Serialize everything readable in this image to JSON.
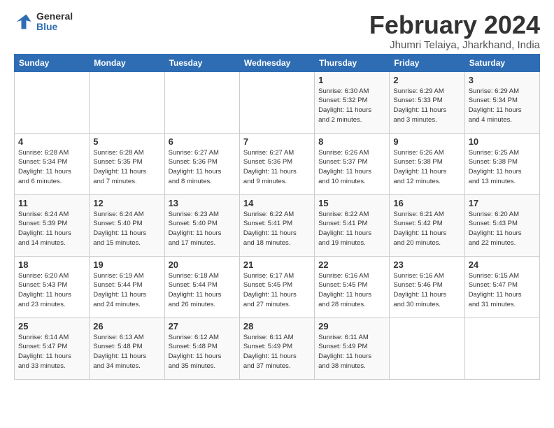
{
  "logo": {
    "general": "General",
    "blue": "Blue"
  },
  "title": "February 2024",
  "location": "Jhumri Telaiya, Jharkhand, India",
  "days_of_week": [
    "Sunday",
    "Monday",
    "Tuesday",
    "Wednesday",
    "Thursday",
    "Friday",
    "Saturday"
  ],
  "weeks": [
    [
      {
        "day": "",
        "info": ""
      },
      {
        "day": "",
        "info": ""
      },
      {
        "day": "",
        "info": ""
      },
      {
        "day": "",
        "info": ""
      },
      {
        "day": "1",
        "info": "Sunrise: 6:30 AM\nSunset: 5:32 PM\nDaylight: 11 hours\nand 2 minutes."
      },
      {
        "day": "2",
        "info": "Sunrise: 6:29 AM\nSunset: 5:33 PM\nDaylight: 11 hours\nand 3 minutes."
      },
      {
        "day": "3",
        "info": "Sunrise: 6:29 AM\nSunset: 5:34 PM\nDaylight: 11 hours\nand 4 minutes."
      }
    ],
    [
      {
        "day": "4",
        "info": "Sunrise: 6:28 AM\nSunset: 5:34 PM\nDaylight: 11 hours\nand 6 minutes."
      },
      {
        "day": "5",
        "info": "Sunrise: 6:28 AM\nSunset: 5:35 PM\nDaylight: 11 hours\nand 7 minutes."
      },
      {
        "day": "6",
        "info": "Sunrise: 6:27 AM\nSunset: 5:36 PM\nDaylight: 11 hours\nand 8 minutes."
      },
      {
        "day": "7",
        "info": "Sunrise: 6:27 AM\nSunset: 5:36 PM\nDaylight: 11 hours\nand 9 minutes."
      },
      {
        "day": "8",
        "info": "Sunrise: 6:26 AM\nSunset: 5:37 PM\nDaylight: 11 hours\nand 10 minutes."
      },
      {
        "day": "9",
        "info": "Sunrise: 6:26 AM\nSunset: 5:38 PM\nDaylight: 11 hours\nand 12 minutes."
      },
      {
        "day": "10",
        "info": "Sunrise: 6:25 AM\nSunset: 5:38 PM\nDaylight: 11 hours\nand 13 minutes."
      }
    ],
    [
      {
        "day": "11",
        "info": "Sunrise: 6:24 AM\nSunset: 5:39 PM\nDaylight: 11 hours\nand 14 minutes."
      },
      {
        "day": "12",
        "info": "Sunrise: 6:24 AM\nSunset: 5:40 PM\nDaylight: 11 hours\nand 15 minutes."
      },
      {
        "day": "13",
        "info": "Sunrise: 6:23 AM\nSunset: 5:40 PM\nDaylight: 11 hours\nand 17 minutes."
      },
      {
        "day": "14",
        "info": "Sunrise: 6:22 AM\nSunset: 5:41 PM\nDaylight: 11 hours\nand 18 minutes."
      },
      {
        "day": "15",
        "info": "Sunrise: 6:22 AM\nSunset: 5:41 PM\nDaylight: 11 hours\nand 19 minutes."
      },
      {
        "day": "16",
        "info": "Sunrise: 6:21 AM\nSunset: 5:42 PM\nDaylight: 11 hours\nand 20 minutes."
      },
      {
        "day": "17",
        "info": "Sunrise: 6:20 AM\nSunset: 5:43 PM\nDaylight: 11 hours\nand 22 minutes."
      }
    ],
    [
      {
        "day": "18",
        "info": "Sunrise: 6:20 AM\nSunset: 5:43 PM\nDaylight: 11 hours\nand 23 minutes."
      },
      {
        "day": "19",
        "info": "Sunrise: 6:19 AM\nSunset: 5:44 PM\nDaylight: 11 hours\nand 24 minutes."
      },
      {
        "day": "20",
        "info": "Sunrise: 6:18 AM\nSunset: 5:44 PM\nDaylight: 11 hours\nand 26 minutes."
      },
      {
        "day": "21",
        "info": "Sunrise: 6:17 AM\nSunset: 5:45 PM\nDaylight: 11 hours\nand 27 minutes."
      },
      {
        "day": "22",
        "info": "Sunrise: 6:16 AM\nSunset: 5:45 PM\nDaylight: 11 hours\nand 28 minutes."
      },
      {
        "day": "23",
        "info": "Sunrise: 6:16 AM\nSunset: 5:46 PM\nDaylight: 11 hours\nand 30 minutes."
      },
      {
        "day": "24",
        "info": "Sunrise: 6:15 AM\nSunset: 5:47 PM\nDaylight: 11 hours\nand 31 minutes."
      }
    ],
    [
      {
        "day": "25",
        "info": "Sunrise: 6:14 AM\nSunset: 5:47 PM\nDaylight: 11 hours\nand 33 minutes."
      },
      {
        "day": "26",
        "info": "Sunrise: 6:13 AM\nSunset: 5:48 PM\nDaylight: 11 hours\nand 34 minutes."
      },
      {
        "day": "27",
        "info": "Sunrise: 6:12 AM\nSunset: 5:48 PM\nDaylight: 11 hours\nand 35 minutes."
      },
      {
        "day": "28",
        "info": "Sunrise: 6:11 AM\nSunset: 5:49 PM\nDaylight: 11 hours\nand 37 minutes."
      },
      {
        "day": "29",
        "info": "Sunrise: 6:11 AM\nSunset: 5:49 PM\nDaylight: 11 hours\nand 38 minutes."
      },
      {
        "day": "",
        "info": ""
      },
      {
        "day": "",
        "info": ""
      }
    ]
  ]
}
